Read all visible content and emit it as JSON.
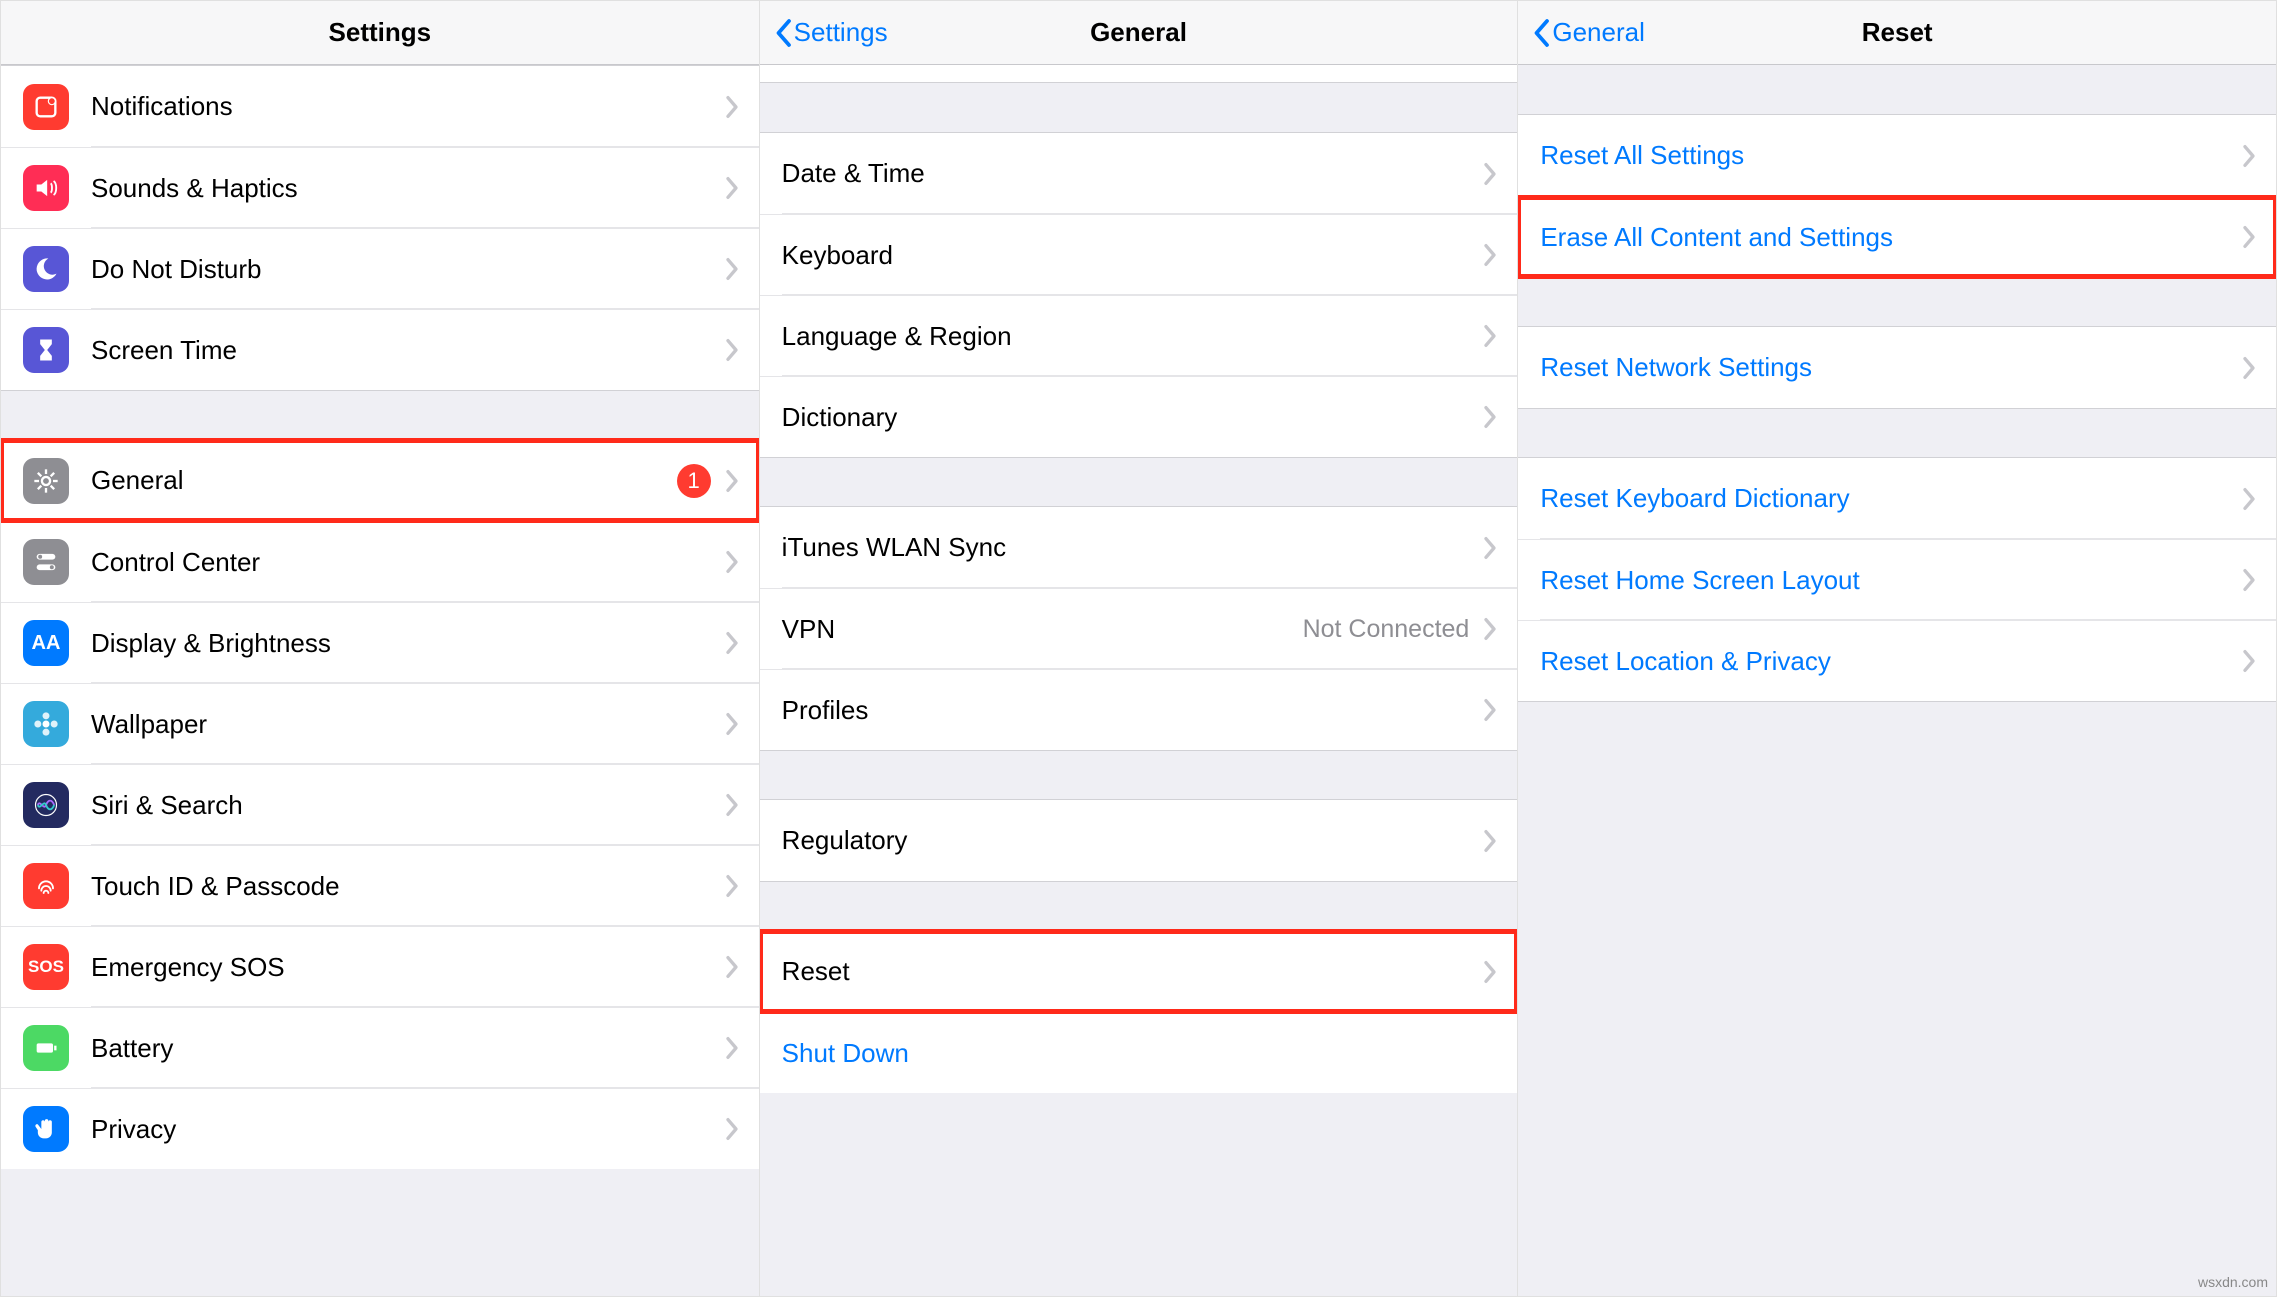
{
  "pane1": {
    "title": "Settings",
    "group1": [
      {
        "id": "notifications",
        "label": "Notifications",
        "color": "#ff3b30",
        "icon": "bell"
      },
      {
        "id": "sounds",
        "label": "Sounds & Haptics",
        "color": "#ff2d55",
        "icon": "speaker"
      },
      {
        "id": "dnd",
        "label": "Do Not Disturb",
        "color": "#5856d6",
        "icon": "moon"
      },
      {
        "id": "screentime",
        "label": "Screen Time",
        "color": "#5856d6",
        "icon": "hourglass"
      }
    ],
    "group2": [
      {
        "id": "general",
        "label": "General",
        "color": "#8e8e93",
        "icon": "gear",
        "badge": "1",
        "highlight": true
      },
      {
        "id": "controlcenter",
        "label": "Control Center",
        "color": "#8e8e93",
        "icon": "switches"
      },
      {
        "id": "display",
        "label": "Display & Brightness",
        "color": "#007aff",
        "icon": "aa"
      },
      {
        "id": "wallpaper",
        "label": "Wallpaper",
        "color": "#34aadc",
        "icon": "flower"
      },
      {
        "id": "siri",
        "label": "Siri & Search",
        "color": "#232a60",
        "icon": "siri"
      },
      {
        "id": "touchid",
        "label": "Touch ID & Passcode",
        "color": "#ff3b30",
        "icon": "fingerprint"
      },
      {
        "id": "sos",
        "label": "Emergency SOS",
        "color": "#ff3b30",
        "icon": "sos"
      },
      {
        "id": "battery",
        "label": "Battery",
        "color": "#4cd964",
        "icon": "battery"
      },
      {
        "id": "privacy",
        "label": "Privacy",
        "color": "#007aff",
        "icon": "hand"
      }
    ]
  },
  "pane2": {
    "back": "Settings",
    "title": "General",
    "g1": [
      {
        "id": "datetime",
        "label": "Date & Time"
      },
      {
        "id": "keyboard",
        "label": "Keyboard"
      },
      {
        "id": "language",
        "label": "Language & Region"
      },
      {
        "id": "dictionary",
        "label": "Dictionary"
      }
    ],
    "g2": [
      {
        "id": "itunes",
        "label": "iTunes WLAN Sync"
      },
      {
        "id": "vpn",
        "label": "VPN",
        "detail": "Not Connected"
      },
      {
        "id": "profiles",
        "label": "Profiles"
      }
    ],
    "g3": [
      {
        "id": "regulatory",
        "label": "Regulatory"
      }
    ],
    "g4": [
      {
        "id": "reset",
        "label": "Reset",
        "highlight": true
      },
      {
        "id": "shutdown",
        "label": "Shut Down",
        "link": true,
        "noChevron": true
      }
    ]
  },
  "pane3": {
    "back": "General",
    "title": "Reset",
    "g1": [
      {
        "id": "resetall",
        "label": "Reset All Settings"
      },
      {
        "id": "eraseall",
        "label": "Erase All Content and Settings",
        "highlight": true
      }
    ],
    "g2": [
      {
        "id": "resetnet",
        "label": "Reset Network Settings"
      }
    ],
    "g3": [
      {
        "id": "resetkbd",
        "label": "Reset Keyboard Dictionary"
      },
      {
        "id": "resethome",
        "label": "Reset Home Screen Layout"
      },
      {
        "id": "resetloc",
        "label": "Reset Location & Privacy"
      }
    ]
  },
  "watermark": "wsxdn.com"
}
